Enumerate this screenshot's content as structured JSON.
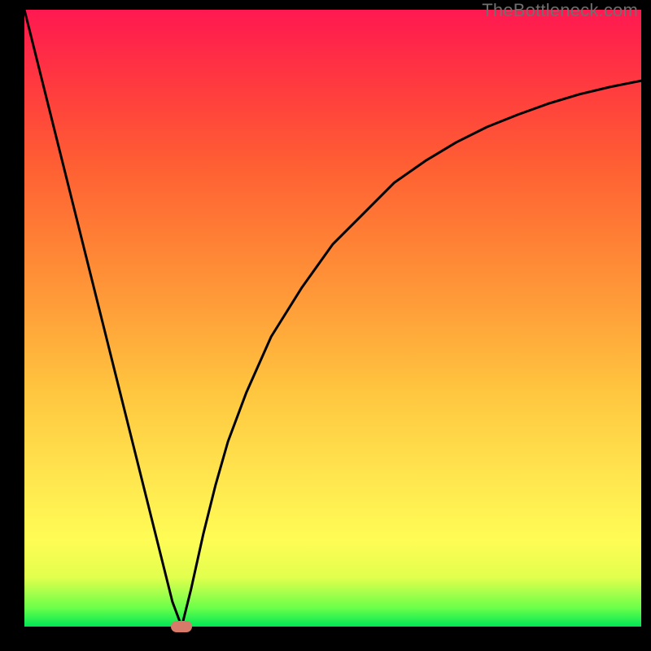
{
  "watermark": "TheBottleneck.com",
  "chart_data": {
    "type": "line",
    "title": "",
    "xlabel": "",
    "ylabel": "",
    "xlim": [
      0,
      100
    ],
    "ylim": [
      0,
      100
    ],
    "grid": false,
    "series": [
      {
        "name": "bottleneck-curve",
        "x": [
          0,
          2,
          4,
          6,
          8,
          10,
          12,
          14,
          16,
          18,
          20,
          22,
          24,
          25.5,
          27,
          29,
          31,
          33,
          36,
          40,
          45,
          50,
          55,
          60,
          65,
          70,
          75,
          80,
          85,
          90,
          95,
          100
        ],
        "values": [
          100,
          92,
          84,
          76,
          68,
          60,
          52,
          44,
          36,
          28,
          20,
          12,
          4,
          0,
          6,
          15,
          23,
          30,
          38,
          47,
          55,
          62,
          67,
          72,
          75.5,
          78.5,
          81,
          83,
          84.8,
          86.3,
          87.5,
          88.5
        ]
      }
    ],
    "annotations": [
      {
        "name": "optimal-marker",
        "x": 25.5,
        "y": 0
      }
    ],
    "background_gradient": {
      "top": "#ff1850",
      "upper_mid": "#ff8235",
      "mid": "#ffe44e",
      "lower_mid": "#e2ff4d",
      "bottom": "#00e756"
    }
  }
}
